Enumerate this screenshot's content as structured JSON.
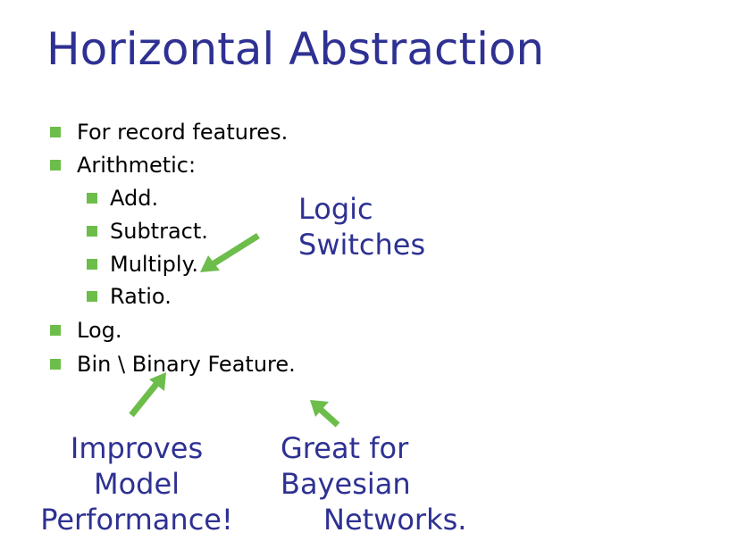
{
  "slide": {
    "title": "Horizontal Abstraction",
    "bullets": [
      {
        "level": 1,
        "text": "For record features."
      },
      {
        "level": 1,
        "text": "Arithmetic:"
      },
      {
        "level": 2,
        "text": "Add."
      },
      {
        "level": 2,
        "text": "Subtract."
      },
      {
        "level": 2,
        "text": "Multiply."
      },
      {
        "level": 2,
        "text": "Ratio."
      },
      {
        "level": 1,
        "text": "Log."
      },
      {
        "level": 1,
        "text": "Bin \\ Binary Feature."
      }
    ],
    "callouts": {
      "logic": {
        "line1": "Logic",
        "line2": "Switches"
      },
      "improves": {
        "line1": "Improves",
        "line2": "Model",
        "line3": "Performance!"
      },
      "bayesian": {
        "line1": "Great for",
        "line2": "Bayesian",
        "line3": "Networks."
      }
    }
  },
  "colors": {
    "title": "#2e3192",
    "bullet_square": "#6dbd4b",
    "arrow": "#6dbd4b",
    "callout_text": "#2e3192"
  }
}
